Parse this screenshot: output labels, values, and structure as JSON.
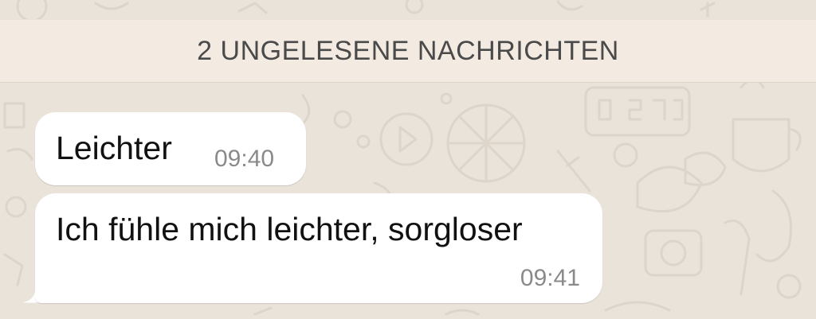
{
  "unread_banner": {
    "text": "2 UNGELESENE NACHRICHTEN"
  },
  "messages": [
    {
      "text": "Leichter",
      "time": "09:40"
    },
    {
      "text": "Ich fühle mich leichter, sorgloser",
      "time": "09:41"
    }
  ],
  "colors": {
    "wallpaper": "#e9e3da",
    "banner": "#f3ebe1",
    "bubble": "#ffffff",
    "time_text": "#8a8a8a"
  }
}
